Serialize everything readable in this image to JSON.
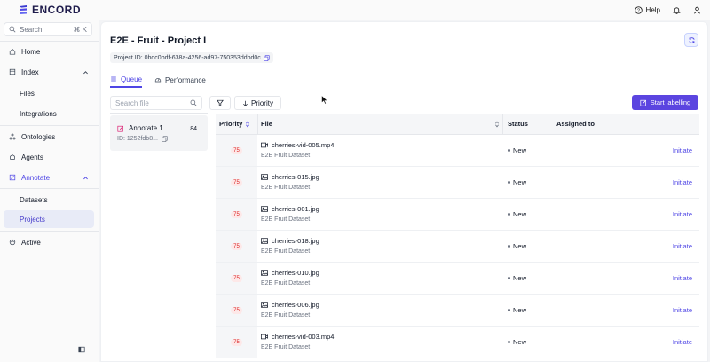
{
  "brand": {
    "name": "ENCORD"
  },
  "topbar": {
    "help_label": "Help"
  },
  "sidebar": {
    "search_placeholder": "Search",
    "search_shortcut": "⌘ K",
    "items": [
      {
        "label": "Home",
        "icon": "home-icon"
      },
      {
        "label": "Index",
        "icon": "index-icon"
      },
      {
        "label": "Files"
      },
      {
        "label": "Integrations"
      },
      {
        "label": "Ontologies",
        "icon": "ontologies-icon"
      },
      {
        "label": "Agents",
        "icon": "agents-icon"
      },
      {
        "label": "Annotate",
        "icon": "annotate-icon"
      },
      {
        "label": "Datasets"
      },
      {
        "label": "Projects"
      },
      {
        "label": "Active",
        "icon": "active-icon"
      }
    ]
  },
  "project": {
    "title": "E2E - Fruit - Project I",
    "id_label": "Project ID: 0bdc0bdf-638a-4256-ad97-750353ddbd0c"
  },
  "tabs": [
    {
      "label": "Queue",
      "active": true
    },
    {
      "label": "Performance",
      "active": false
    }
  ],
  "toolbar": {
    "search_placeholder": "Search file",
    "priority_label": "Priority",
    "start_label": "Start labelling"
  },
  "task": {
    "name": "Annotate 1",
    "count": "84",
    "id": "ID: 1252fdb8..."
  },
  "table": {
    "headers": {
      "priority": "Priority",
      "file": "File",
      "status": "Status",
      "assigned": "Assigned to"
    },
    "rows": [
      {
        "priority": "75",
        "file": "cherries-vid-005.mp4",
        "type": "video",
        "dataset": "E2E Fruit Dataset",
        "status": "New",
        "action": "Initiate"
      },
      {
        "priority": "75",
        "file": "cherries-015.jpg",
        "type": "image",
        "dataset": "E2E Fruit Dataset",
        "status": "New",
        "action": "Initiate"
      },
      {
        "priority": "75",
        "file": "cherries-001.jpg",
        "type": "image",
        "dataset": "E2E Fruit Dataset",
        "status": "New",
        "action": "Initiate"
      },
      {
        "priority": "75",
        "file": "cherries-018.jpg",
        "type": "image",
        "dataset": "E2E Fruit Dataset",
        "status": "New",
        "action": "Initiate"
      },
      {
        "priority": "75",
        "file": "cherries-010.jpg",
        "type": "image",
        "dataset": "E2E Fruit Dataset",
        "status": "New",
        "action": "Initiate"
      },
      {
        "priority": "75",
        "file": "cherries-006.jpg",
        "type": "image",
        "dataset": "E2E Fruit Dataset",
        "status": "New",
        "action": "Initiate"
      },
      {
        "priority": "75",
        "file": "cherries-vid-003.mp4",
        "type": "video",
        "dataset": "E2E Fruit Dataset",
        "status": "New",
        "action": "Initiate"
      }
    ]
  },
  "colors": {
    "accent": "#5b45e0",
    "priority_badge": "#dc2626"
  }
}
